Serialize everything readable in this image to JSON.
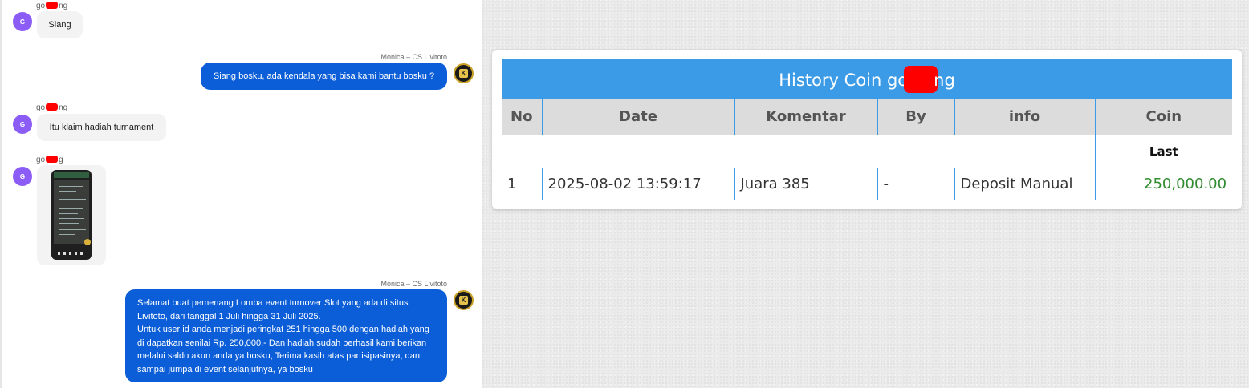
{
  "chat": {
    "messages": [
      {
        "sender_prefix": "go",
        "sender_suffix": "ng",
        "avatar_letter": "G",
        "text": "Siang"
      },
      {
        "agent": "Monica – CS Livitoto",
        "text": "Siang bosku, ada kendala yang bisa kami bantu bosku ?"
      },
      {
        "sender_prefix": "go",
        "sender_suffix": "ng",
        "avatar_letter": "G",
        "text": "Itu klaim hadiah turnament"
      },
      {
        "sender_prefix": "go",
        "sender_suffix": "g",
        "avatar_letter": "G",
        "attachment": "screenshot-image"
      },
      {
        "agent": "Monica – CS Livitoto",
        "lines": [
          "Selamat buat pemenang Lomba event turnover Slot yang ada di situs",
          "Livitoto, dari tanggal 1 Juli hingga 31 Juli 2025.",
          "Untuk user id anda menjadi peringkat 251 hingga 500 dengan hadiah yang",
          "di dapatkan senilai Rp. 250,000,- Dan hadiah sudah berhasil kami berikan",
          "melalui saldo akun anda ya bosku, Terima kasih atas partisipasinya, dan",
          "sampai jumpa di event selanjutnya, ya bosku"
        ]
      }
    ],
    "agent_avatar_glyph": "K",
    "colors": {
      "outgoing": "#0b5ed7",
      "incoming": "#f3f3f3",
      "avatar": "#8b5cf6"
    }
  },
  "history": {
    "title_prefix": "History Coin go",
    "title_suffix": "ng",
    "columns": [
      "No",
      "Date",
      "Komentar",
      "By",
      "info",
      "Coin"
    ],
    "subheader_last": "Last",
    "rows": [
      {
        "no": "1",
        "date": "2025-08-02 13:59:17",
        "komentar": "Juara 385",
        "by": "-",
        "info": "Deposit Manual",
        "coin": "250,000.00"
      }
    ],
    "colors": {
      "header": "#3c9be6",
      "coin_positive": "#2e8b2e"
    }
  }
}
